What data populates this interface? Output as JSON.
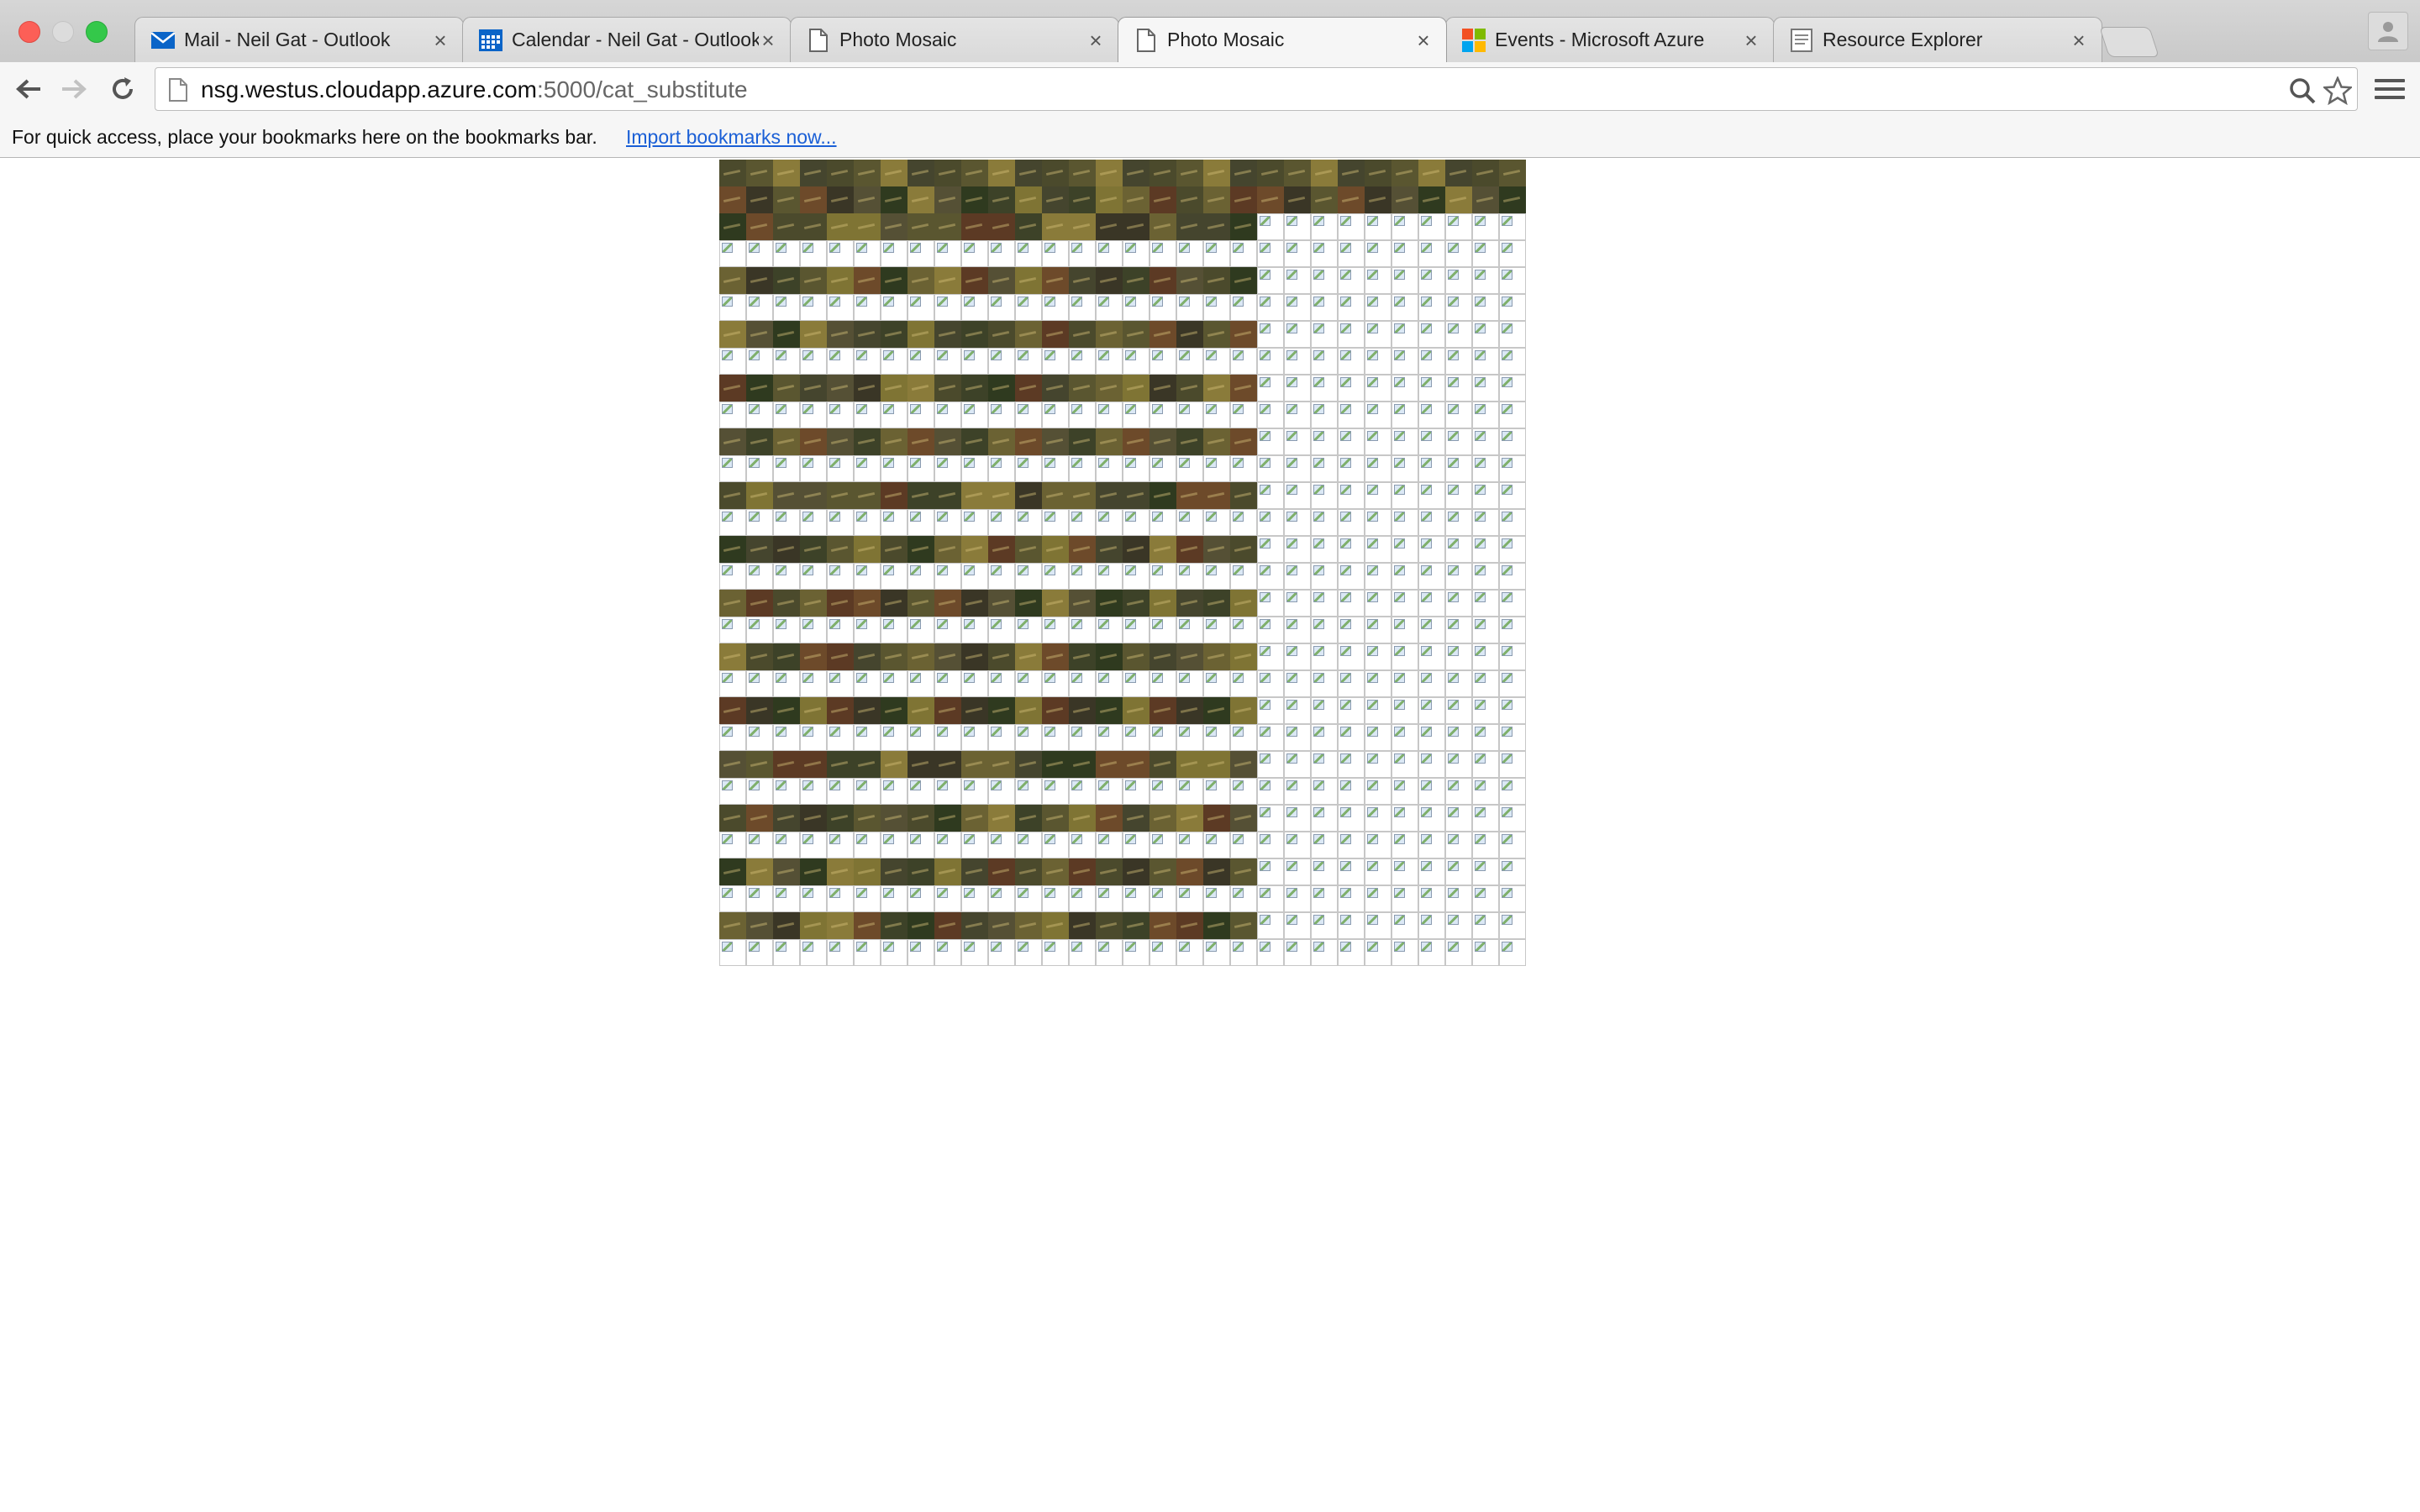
{
  "window": {
    "tabs": [
      {
        "title": "Mail - Neil Gat - Outlook",
        "icon": "outlook-mail-icon",
        "active": false
      },
      {
        "title": "Calendar - Neil Gat - Outlook",
        "icon": "outlook-calendar-icon",
        "active": false
      },
      {
        "title": "Photo Mosaic",
        "icon": "page-icon",
        "active": false
      },
      {
        "title": "Photo Mosaic",
        "icon": "page-icon",
        "active": true
      },
      {
        "title": "Events - Microsoft Azure",
        "icon": "microsoft-icon",
        "active": false
      },
      {
        "title": "Resource Explorer",
        "icon": "document-icon",
        "active": false
      }
    ],
    "close_glyph": "×"
  },
  "toolbar": {
    "url_host": "nsg.westus.cloudapp.azure.com",
    "url_rest": ":5000/cat_substitute"
  },
  "bookmarks_bar": {
    "message": "For quick access, place your bookmarks here on the bookmarks bar.",
    "import_link": "Import bookmarks now..."
  },
  "mosaic": {
    "columns": 30,
    "rows": 30,
    "photo_palette": [
      "#4b4a2c",
      "#3d4228",
      "#2f3a1f",
      "#5a5630",
      "#6b6233",
      "#7f7434",
      "#8a7b3a",
      "#6d4a2a",
      "#5c3a24",
      "#45452e",
      "#555035",
      "#3a3626"
    ],
    "row_pattern": [
      {
        "photos": 30
      },
      {
        "photos": 30
      },
      {
        "photos": 20
      },
      {
        "photos": 0
      },
      {
        "photos": 20
      },
      {
        "photos": 0
      },
      {
        "photos": 20
      },
      {
        "photos": 0
      },
      {
        "photos": 20
      },
      {
        "photos": 0
      },
      {
        "photos": 20
      },
      {
        "photos": 0
      },
      {
        "photos": 20
      },
      {
        "photos": 0
      },
      {
        "photos": 20
      },
      {
        "photos": 0
      },
      {
        "photos": 20
      },
      {
        "photos": 0
      },
      {
        "photos": 20
      },
      {
        "photos": 0
      },
      {
        "photos": 20
      },
      {
        "photos": 0
      },
      {
        "photos": 20
      },
      {
        "photos": 0
      },
      {
        "photos": 20
      },
      {
        "photos": 0
      },
      {
        "photos": 20
      },
      {
        "photos": 0
      },
      {
        "photos": 20
      },
      {
        "photos": 0
      }
    ]
  }
}
